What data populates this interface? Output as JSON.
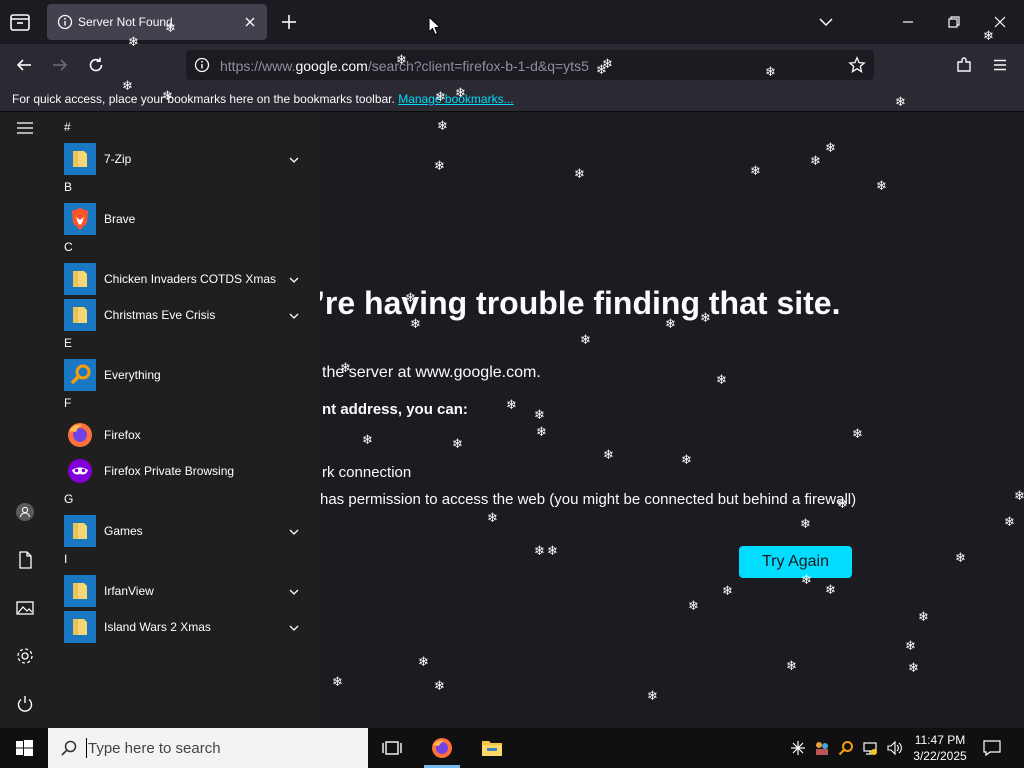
{
  "browser": {
    "tab_title": "Server Not Found",
    "url_prefix": "https://www.",
    "url_host": "google.com",
    "url_rest": "/search?client=firefox-b-1-d&q=yts5",
    "bookmarks_hint": "For quick access, place your bookmarks here on the bookmarks toolbar.",
    "bookmarks_link": "Manage bookmarks..."
  },
  "error_page": {
    "title": "’re having trouble finding that site.",
    "line1": " the server at www.google.com.",
    "line2": "nt address, you can:",
    "item1": "rk connection",
    "item2": " has permission to access the web (you might be connected but behind a firewall)",
    "try_again": "Try Again",
    "accent": "#00ddff"
  },
  "start_menu": {
    "groups": [
      {
        "letter": "#",
        "apps": [
          {
            "name": "7-Zip",
            "icon": "folder-icon",
            "expandable": true
          }
        ]
      },
      {
        "letter": "B",
        "apps": [
          {
            "name": "Brave",
            "icon": "brave-icon",
            "expandable": false
          }
        ]
      },
      {
        "letter": "C",
        "apps": [
          {
            "name": "Chicken Invaders COTDS Xmas",
            "icon": "folder-icon",
            "expandable": true
          },
          {
            "name": "Christmas Eve Crisis",
            "icon": "folder-icon",
            "expandable": true
          }
        ]
      },
      {
        "letter": "E",
        "apps": [
          {
            "name": "Everything",
            "icon": "magnifier-icon",
            "expandable": false
          }
        ]
      },
      {
        "letter": "F",
        "apps": [
          {
            "name": "Firefox",
            "icon": "firefox-icon",
            "expandable": false
          },
          {
            "name": "Firefox Private Browsing",
            "icon": "firefox-private-icon",
            "expandable": false
          }
        ]
      },
      {
        "letter": "G",
        "apps": [
          {
            "name": "Games",
            "icon": "folder-icon",
            "expandable": true
          }
        ]
      },
      {
        "letter": "I",
        "apps": [
          {
            "name": "IrfanView",
            "icon": "folder-icon",
            "expandable": true
          },
          {
            "name": "Island Wars 2 Xmas",
            "icon": "folder-icon",
            "expandable": true
          }
        ]
      }
    ]
  },
  "taskbar": {
    "search_placeholder": "Type here to search",
    "time": "11:47 PM",
    "date": "3/22/2025"
  }
}
